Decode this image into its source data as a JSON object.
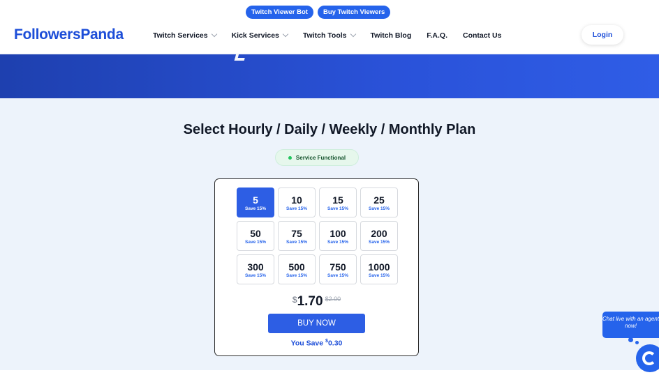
{
  "header": {
    "promo_pills": [
      "Twitch Viewer Bot",
      "Buy Twitch Viewers"
    ],
    "logo": "FollowersPanda",
    "nav": [
      {
        "label": "Twitch Services",
        "dropdown": true
      },
      {
        "label": "Kick Services",
        "dropdown": true
      },
      {
        "label": "Twitch Tools",
        "dropdown": true
      },
      {
        "label": "Twitch Blog",
        "dropdown": false
      },
      {
        "label": "F.A.Q.",
        "dropdown": false
      },
      {
        "label": "Contact Us",
        "dropdown": false
      }
    ],
    "login_label": "Login"
  },
  "plan": {
    "title": "Select Hourly / Daily / Weekly / Monthly Plan",
    "status": "Service Functional",
    "options": [
      {
        "amount": "5",
        "save": "Save 15%",
        "selected": true
      },
      {
        "amount": "10",
        "save": "Save 15%",
        "selected": false
      },
      {
        "amount": "15",
        "save": "Save 15%",
        "selected": false
      },
      {
        "amount": "25",
        "save": "Save 15%",
        "selected": false
      },
      {
        "amount": "50",
        "save": "Save 15%",
        "selected": false
      },
      {
        "amount": "75",
        "save": "Save 15%",
        "selected": false
      },
      {
        "amount": "100",
        "save": "Save 15%",
        "selected": false
      },
      {
        "amount": "200",
        "save": "Save 15%",
        "selected": false
      },
      {
        "amount": "300",
        "save": "Save 15%",
        "selected": false
      },
      {
        "amount": "500",
        "save": "Save 15%",
        "selected": false
      },
      {
        "amount": "750",
        "save": "Save 15%",
        "selected": false
      },
      {
        "amount": "1000",
        "save": "Save 15%",
        "selected": false
      }
    ],
    "price": {
      "currency": "$",
      "amount": "1.70",
      "old": "$2.00"
    },
    "buy_label": "BUY NOW",
    "save_prefix": "You Save ",
    "save_currency": "$",
    "save_amount": "0.30"
  },
  "chat": {
    "text": "Chat live with an agent now!"
  },
  "colors": {
    "accent": "#2563eb",
    "status_dot": "#22c55e"
  }
}
